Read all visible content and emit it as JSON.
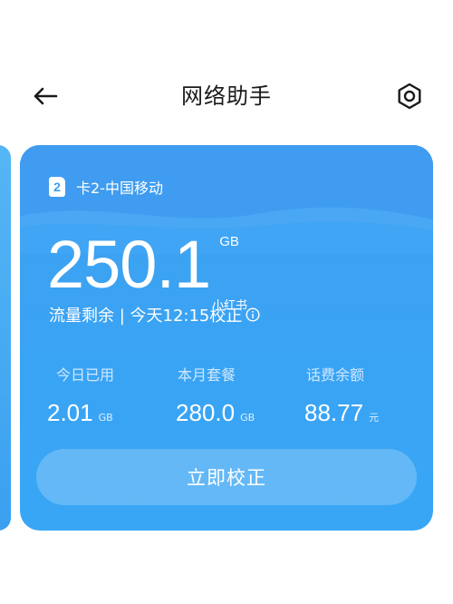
{
  "header": {
    "title": "网络助手"
  },
  "card": {
    "sim_badge": "2",
    "sim_label": "卡2-中国移动",
    "remaining_value": "250.1",
    "remaining_unit": "GB",
    "status_text": "流量剩余 | 今天12:15校正",
    "watermark": "小红书",
    "stats": [
      {
        "label": "今日已用",
        "value": "2.01",
        "unit": "GB"
      },
      {
        "label": "本月套餐",
        "value": "280.0",
        "unit": "GB"
      },
      {
        "label": "话费余额",
        "value": "88.77",
        "unit": "元"
      }
    ],
    "calibrate_button": "立即校正"
  },
  "colors": {
    "card_blue": "#3aa4f4",
    "text_dark": "#1a1a1a"
  },
  "icons": [
    "back-arrow-icon",
    "settings-icon",
    "sim-card-icon",
    "info-icon"
  ]
}
